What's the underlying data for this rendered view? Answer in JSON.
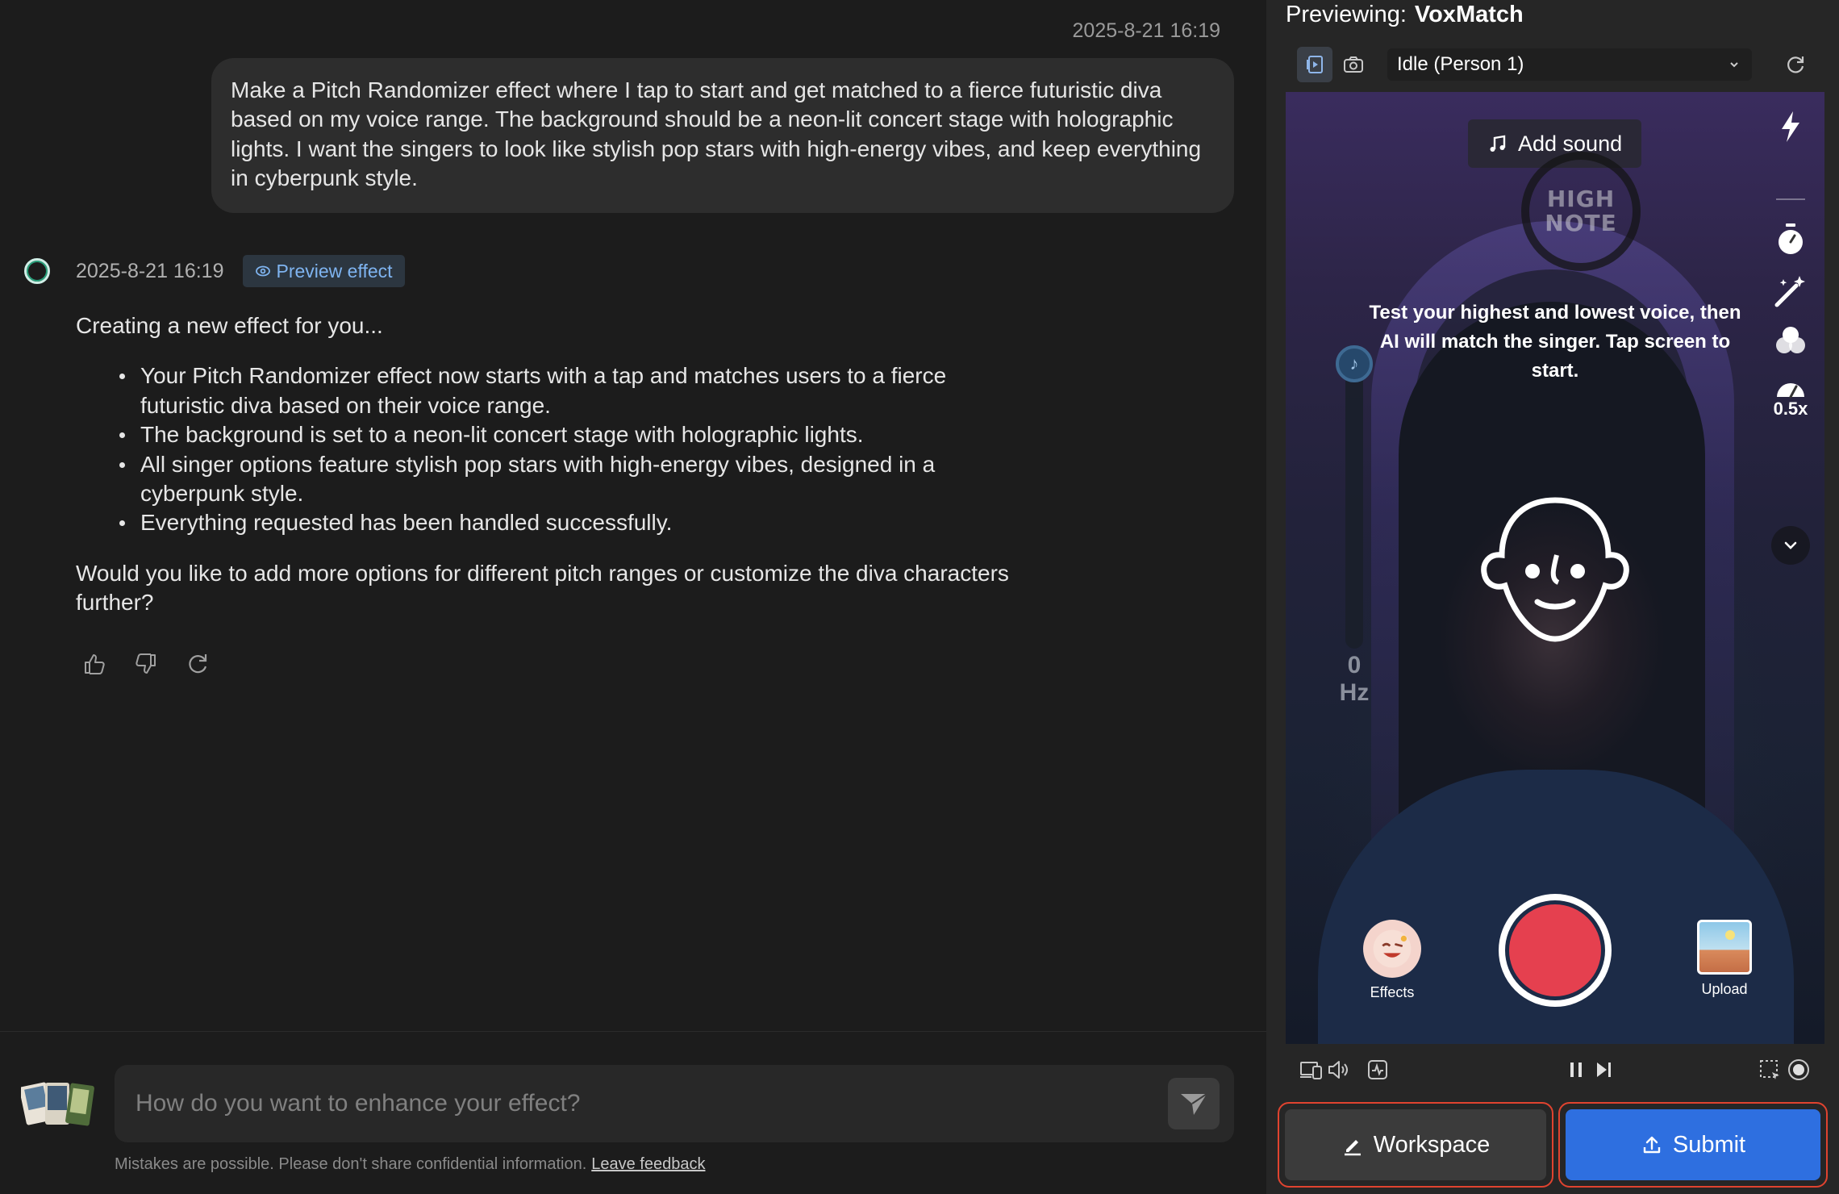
{
  "chat": {
    "user_message": {
      "timestamp": "2025-8-21 16:19",
      "text": "Make a Pitch Randomizer effect where I tap to start and get matched to a fierce futuristic diva based on my voice range. The background should be a neon-lit concert stage with holographic lights. I want the singers to look like stylish pop stars with high-energy vibes, and keep everything in cyberpunk style."
    },
    "ai_message": {
      "timestamp": "2025-8-21 16:19",
      "preview_label": "Preview effect",
      "intro": "Creating a new effect for you...",
      "bullets": [
        "Your Pitch Randomizer effect now starts with a tap and matches users to a fierce futuristic diva based on their voice range.",
        "The background is set to a neon-lit concert stage with holographic lights.",
        "All singer options feature stylish pop stars with high-energy vibes, designed in a cyberpunk style.",
        "Everything requested has been handled successfully."
      ],
      "outro": "Would you like to add more options for different pitch ranges or customize the diva characters further?"
    },
    "composer": {
      "placeholder": "How do you want to enhance your effect?"
    },
    "disclaimer": "Mistakes are possible. Please don't share confidential information.",
    "feedback_link": "Leave feedback"
  },
  "preview": {
    "label": "Previewing:",
    "effect_name": "VoxMatch",
    "state_select": "Idle (Person 1)",
    "add_sound": "Add sound",
    "badge_line1": "HIGH",
    "badge_line2": "NOTE",
    "instructions": "Test your highest and lowest voice, then AI will match the singer. Tap screen to start.",
    "meter_value": "0",
    "meter_unit": "Hz",
    "speed_label": "0.5x",
    "effects_label": "Effects",
    "upload_label": "Upload",
    "workspace_label": "Workspace",
    "submit_label": "Submit"
  },
  "colors": {
    "accent_blue": "#2e6fe0",
    "record_red": "#e5404f",
    "highlight_outline": "#e0432f",
    "chip_text": "#7fb4f0"
  }
}
